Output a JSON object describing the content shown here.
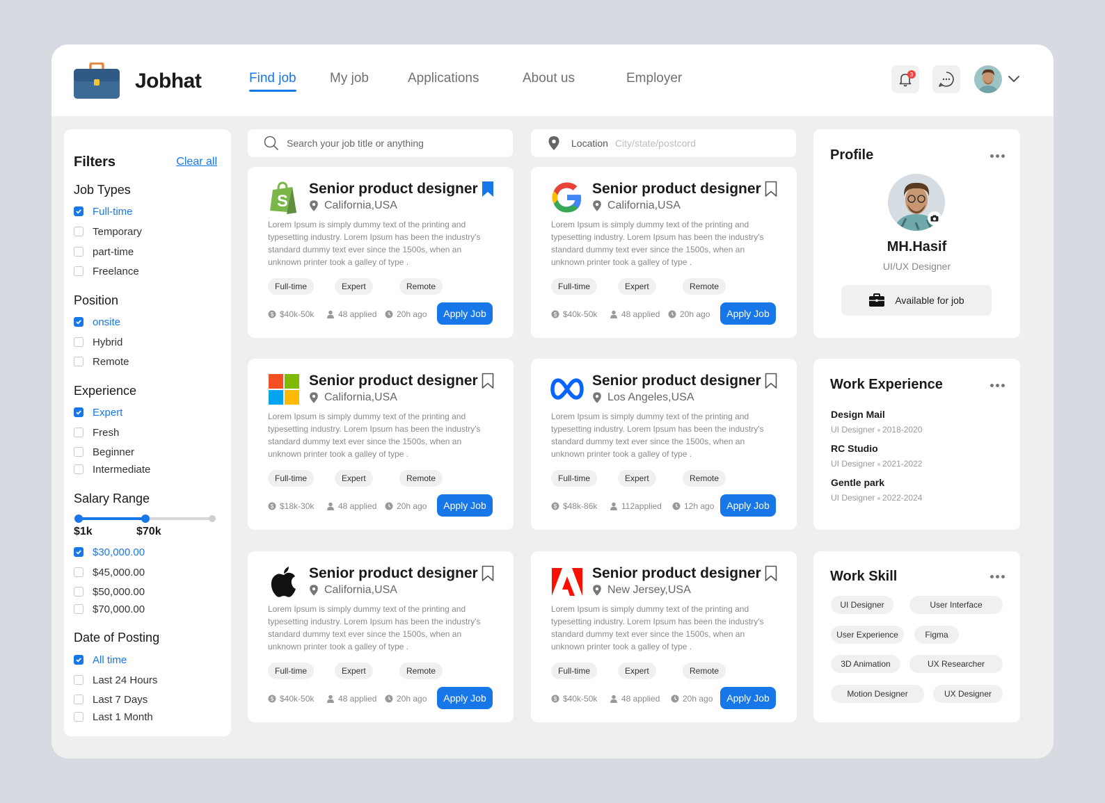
{
  "brand": {
    "name": "Jobhat"
  },
  "nav": [
    {
      "label": "Find job",
      "active": true
    },
    {
      "label": "My job",
      "active": false
    },
    {
      "label": "Applications",
      "active": false
    },
    {
      "label": "About us",
      "active": false
    },
    {
      "label": "Employer",
      "active": false
    }
  ],
  "header": {
    "notification_count": "3",
    "icons": [
      "bell-icon",
      "chat-icon",
      "chevron-down-icon"
    ]
  },
  "filters": {
    "title": "Filters",
    "clear_label": "Clear all",
    "job_types": {
      "title": "Job Types",
      "options": [
        {
          "label": "Full-time",
          "checked": true
        },
        {
          "label": "Temporary",
          "checked": false
        },
        {
          "label": "part-time",
          "checked": false
        },
        {
          "label": "Freelance",
          "checked": false
        }
      ]
    },
    "position": {
      "title": "Position",
      "options": [
        {
          "label": "onsite",
          "checked": true
        },
        {
          "label": "Hybrid",
          "checked": false
        },
        {
          "label": "Remote",
          "checked": false
        }
      ]
    },
    "experience": {
      "title": "Experience",
      "options": [
        {
          "label": "Expert",
          "checked": true
        },
        {
          "label": "Fresh",
          "checked": false
        },
        {
          "label": "Beginner",
          "checked": false
        },
        {
          "label": "Intermediate",
          "checked": false
        }
      ]
    },
    "salary": {
      "title": "Salary Range",
      "min_label": "$1k",
      "max_label": "$70k",
      "range_fraction": 0.5,
      "options": [
        {
          "label": "$30,000.00",
          "checked": true
        },
        {
          "label": "$45,000.00",
          "checked": false
        },
        {
          "label": "$50,000.00",
          "checked": false
        },
        {
          "label": "$70,000.00",
          "checked": false
        }
      ]
    },
    "date": {
      "title": "Date of Posting",
      "options": [
        {
          "label": "All time",
          "checked": true
        },
        {
          "label": "Last 24 Hours",
          "checked": false
        },
        {
          "label": "Last 7 Days",
          "checked": false
        },
        {
          "label": "Last 1 Month",
          "checked": false
        }
      ]
    }
  },
  "search": {
    "placeholder": "Search your job title or anything",
    "location_label": "Location",
    "location_placeholder": "City/state/postcord"
  },
  "jobs": [
    {
      "company_icon": "shopify-logo",
      "title": "Senior product designer",
      "location": "California,USA",
      "bookmarked": true,
      "desc": "Lorem Ipsum is simply dummy text of the printing and typesetting industry. Lorem Ipsum has been the industry's standard dummy text ever since the 1500s, when an unknown printer took a galley of type .",
      "tags": [
        "Full-time",
        "Expert",
        "Remote"
      ],
      "salary": "$40k-50k",
      "applied": "48 applied",
      "posted": "20h ago",
      "apply_label": "Apply Job"
    },
    {
      "company_icon": "google-logo",
      "title": "Senior product designer",
      "location": "California,USA",
      "bookmarked": false,
      "desc": "Lorem Ipsum is simply dummy text of the printing and typesetting industry. Lorem Ipsum has been the industry's standard dummy text ever since the 1500s, when an unknown printer took a galley of type .",
      "tags": [
        "Full-time",
        "Expert",
        "Remote"
      ],
      "salary": "$40k-50k",
      "applied": "48 applied",
      "posted": "20h ago",
      "apply_label": "Apply Job"
    },
    {
      "company_icon": "microsoft-logo",
      "title": "Senior product designer",
      "location": "California,USA",
      "bookmarked": false,
      "desc": "Lorem Ipsum is simply dummy text of the printing and typesetting industry. Lorem Ipsum has been the industry's standard dummy text ever since the 1500s, when an unknown printer took a galley of type .",
      "tags": [
        "Full-time",
        "Expert",
        "Remote"
      ],
      "salary": "$18k-30k",
      "applied": "48 applied",
      "posted": "20h ago",
      "apply_label": "Apply Job"
    },
    {
      "company_icon": "meta-logo",
      "title": "Senior product designer",
      "location": "Los Angeles,USA",
      "bookmarked": false,
      "desc": "Lorem Ipsum is simply dummy text of the printing and typesetting industry. Lorem Ipsum has been the industry's standard dummy text ever since the 1500s, when an unknown printer took a galley of type .",
      "tags": [
        "Full-time",
        "Expert",
        "Remote"
      ],
      "salary": "$48k-86k",
      "applied": "112applied",
      "posted": "12h ago",
      "apply_label": "Apply Job"
    },
    {
      "company_icon": "apple-logo",
      "title": "Senior product designer",
      "location": "California,USA",
      "bookmarked": false,
      "desc": "Lorem Ipsum is simply dummy text of the printing and typesetting industry. Lorem Ipsum has been the industry's standard dummy text ever since the 1500s, when an unknown printer took a galley of type .",
      "tags": [
        "Full-time",
        "Expert",
        "Remote"
      ],
      "salary": "$40k-50k",
      "applied": "48 applied",
      "posted": "20h ago",
      "apply_label": "Apply Job"
    },
    {
      "company_icon": "adobe-logo",
      "title": "Senior product designer",
      "location": "New Jersey,USA",
      "bookmarked": false,
      "desc": "Lorem Ipsum is simply dummy text of the printing and typesetting industry. Lorem Ipsum has been the industry's standard dummy text ever since the 1500s, when an unknown printer took a galley of type .",
      "tags": [
        "Full-time",
        "Expert",
        "Remote"
      ],
      "salary": "$40k-50k",
      "applied": "48 applied",
      "posted": "20h ago",
      "apply_label": "Apply Job"
    }
  ],
  "profile": {
    "title": "Profile",
    "name": "MH.Hasif",
    "role": "UI/UX Designer",
    "status_label": "Available for job"
  },
  "experience_panel": {
    "title": "Work Experience",
    "items": [
      {
        "company": "Design Mail",
        "role": "UI Designer",
        "period": "2018-2020"
      },
      {
        "company": "RC Studio",
        "role": "UI Designer",
        "period": "2021-2022"
      },
      {
        "company": "Gentle park",
        "role": "UI Designer",
        "period": "2022-2024"
      }
    ]
  },
  "skills_panel": {
    "title": "Work Skill",
    "items": [
      "UI Designer",
      "User Interface",
      "User Experience",
      "Figma",
      "3D Animation",
      "UX Researcher",
      "Motion Designer",
      "UX Designer"
    ]
  },
  "colors": {
    "accent": "#1877e8",
    "background": "#d7dae1",
    "surface": "#ffffff"
  }
}
